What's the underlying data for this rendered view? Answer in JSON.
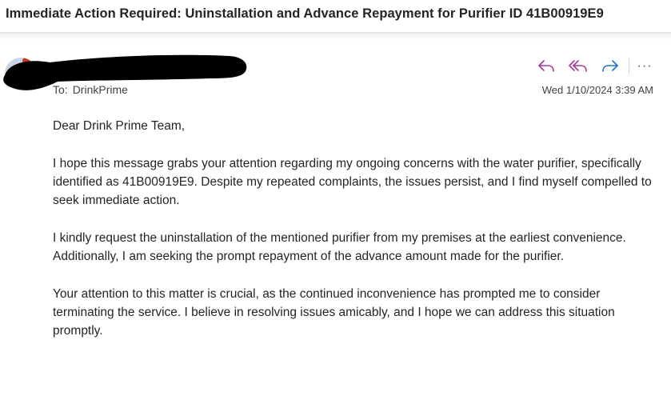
{
  "email": {
    "subject": "Immediate Action Required: Uninstallation and Advance Repayment for Purifier ID 41B00919E9",
    "to_label": "To:",
    "to": "DrinkPrime",
    "datetime": "Wed 1/10/2024 3:39 AM",
    "actions": {
      "reply_icon": "reply-icon",
      "reply_all_icon": "reply-all-icon",
      "forward_icon": "forward-icon",
      "more_label": "···"
    },
    "body": {
      "greeting": "Dear Drink Prime Team,",
      "para1": "I hope this message grabs your attention regarding my ongoing concerns with the water purifier, specifically identified as 41B00919E9. Despite my repeated complaints, the issues persist, and I find myself compelled to seek immediate action.",
      "para2": "I kindly request the uninstallation of the mentioned purifier from my premises at the earliest convenience. Additionally, I am seeking the prompt repayment of the advance amount made for the purifier.",
      "para3": "Your attention to this matter is crucial, as the continued inconvenience has prompted me to consider terminating the service. I believe in resolving issues amicably, and I hope we can address this situation promptly."
    }
  },
  "colors": {
    "accent_purple": "#a4389c",
    "accent_blue": "#1f74c8",
    "text": "#242424"
  }
}
